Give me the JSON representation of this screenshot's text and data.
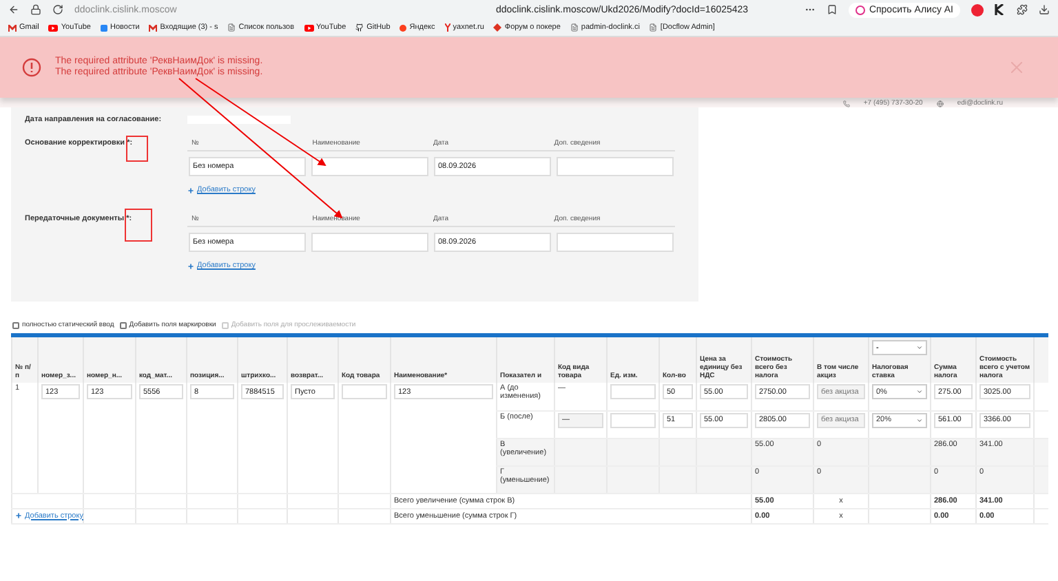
{
  "browser": {
    "host": "ddoclink.cislink.moscow",
    "url": "ddoclink.cislink.moscow/Ukd2026/Modify?docId=16025423",
    "alice_button": "Спросить Алису AI"
  },
  "bookmarks": [
    {
      "label": "Gmail",
      "kind": "gmail"
    },
    {
      "label": "YouTube",
      "kind": "youtube"
    },
    {
      "label": "Новости",
      "kind": "vk"
    },
    {
      "label": "Входящие (3) - s",
      "kind": "gmail"
    },
    {
      "label": "Список пользов",
      "kind": "page"
    },
    {
      "label": "YouTube",
      "kind": "youtube"
    },
    {
      "label": "GitHub",
      "kind": "github"
    },
    {
      "label": "Яндекс",
      "kind": "yandex"
    },
    {
      "label": "yaxnet.ru",
      "kind": "ya"
    },
    {
      "label": "Форум о покере",
      "kind": "forum"
    },
    {
      "label": "padmin-doclink.ci",
      "kind": "page"
    },
    {
      "label": "[Docflow Admin]",
      "kind": "page"
    }
  ],
  "alert": {
    "messages": [
      "The required attribute 'РеквНаимДок' is missing.",
      "The required attribute 'РеквНаимДок' is missing."
    ]
  },
  "contacts": {
    "phone": "+7 (495) 737-30-20",
    "email": "edi@doclink.ru"
  },
  "form": {
    "approval_date_label": "Дата направления на согласование:",
    "sections": [
      {
        "label": "Основание корректировки ",
        "marker": "*:",
        "columns": [
          "№",
          "Наименование",
          "Дата",
          "Доп. сведения"
        ],
        "cells": [
          {
            "value": "Без номера"
          },
          {},
          {
            "value": "08.09.2026"
          },
          {}
        ],
        "add_link": "Добавить строку"
      },
      {
        "label": "Передаточные документы ",
        "marker": "*:",
        "columns": [
          "№",
          "Наименование",
          "Дата",
          "Доп. сведения"
        ],
        "cells": [
          {
            "value": "Без номера"
          },
          {},
          {
            "value": "08.09.2026"
          },
          {}
        ],
        "add_link": "Добавить строку"
      }
    ]
  },
  "options": [
    {
      "label": "полностью статический ввод",
      "checked": false,
      "disabled": false
    },
    {
      "label": "Добавить поля маркировки",
      "checked": false,
      "disabled": false
    },
    {
      "label": "Добавить поля для прослеживаемости",
      "checked": false,
      "disabled": true
    }
  ],
  "table": {
    "columns": [
      {
        "label": "№ п/п"
      },
      {
        "label": "номер_з..."
      },
      {
        "label": "номер_н..."
      },
      {
        "label": "код_мат..."
      },
      {
        "label": "позиция..."
      },
      {
        "label": "штрихко..."
      },
      {
        "label": "возврат..."
      },
      {
        "label": "Код товара"
      },
      {
        "label": "Наименование*"
      },
      {
        "label": "Показател и"
      },
      {
        "label": "Код вида товара"
      },
      {
        "label": "Ед. изм."
      },
      {
        "label": "Кол-во"
      },
      {
        "label": "Цена за единицу без НДС"
      },
      {
        "label": "Стоимость всего без налога"
      },
      {
        "label": "В том числе акциз"
      },
      {
        "label": "Налоговая ставка",
        "select": "-"
      },
      {
        "label": "Сумма налога"
      },
      {
        "label": "Стоимость всего с учетом налога"
      }
    ],
    "item": {
      "number": "1",
      "fields": [
        {
          "kind": "input",
          "value": "123"
        },
        {
          "kind": "input",
          "value": "123"
        },
        {
          "kind": "input",
          "value": "5556"
        },
        {
          "kind": "input",
          "value": "8"
        },
        {
          "kind": "input",
          "value": "7884515"
        },
        {
          "kind": "input",
          "value": "Пусто"
        },
        {
          "kind": "input"
        },
        {
          "kind": "input",
          "value": "123"
        }
      ],
      "lines": [
        {
          "kind": "before",
          "indicator": "А (до изменения)",
          "code": "—",
          "qty": "50",
          "price": "55.00",
          "cost": "2750.00",
          "excise_placeholder": "без акциза",
          "rate": "0%",
          "tax": "275.00",
          "total": "3025.00"
        },
        {
          "kind": "after",
          "indicator": "Б (после)",
          "code": "—",
          "qty": "51",
          "price": "55.00",
          "cost": "2805.00",
          "excise_placeholder": "без акциза",
          "rate": "20%",
          "tax": "561.00",
          "total": "3366.00"
        },
        {
          "kind": "calc",
          "indicator": "В (увеличение)",
          "cost": "55.00",
          "excise": "0",
          "tax": "286.00",
          "total": "341.00"
        },
        {
          "kind": "calc",
          "indicator": "Г (уменьшение)",
          "cost": "0",
          "excise": "0",
          "tax": "0",
          "total": "0"
        }
      ]
    },
    "totals": [
      {
        "label": "Всего увеличение (сумма строк В)",
        "cost": "55.00",
        "excise": "x",
        "tax": "286.00",
        "total": "341.00"
      },
      {
        "label": "Всего уменьшение (сумма строк Г)",
        "cost": "0.00",
        "excise": "x",
        "tax": "0.00",
        "total": "0.00"
      }
    ],
    "add_link": "Добавить строку"
  }
}
